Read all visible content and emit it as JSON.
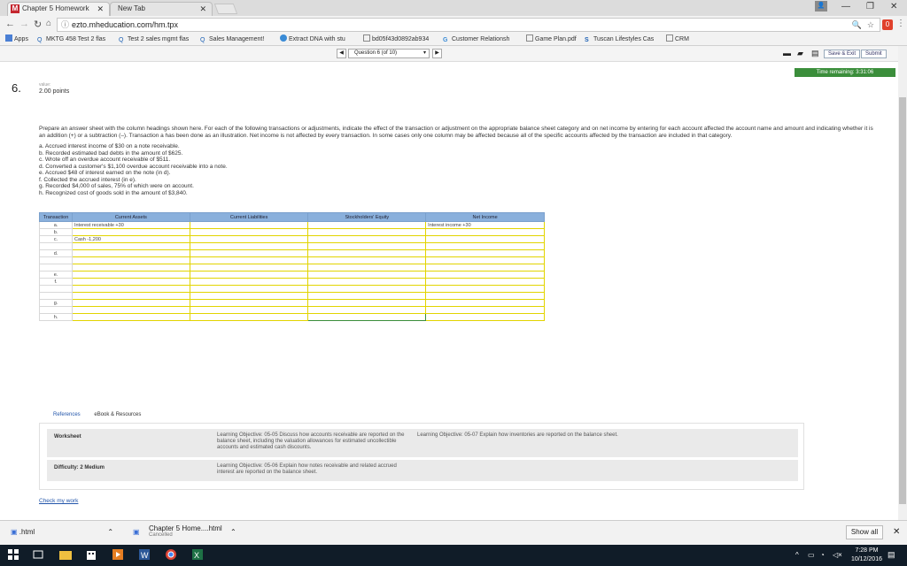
{
  "browser": {
    "tabs": [
      {
        "label": "Chapter 5 Homework",
        "active": true
      },
      {
        "label": "New Tab",
        "active": false
      }
    ],
    "url": "ezto.mheducation.com/hm.tpx",
    "bookmarks": [
      {
        "label": "Apps"
      },
      {
        "label": "MKTG 458 Test 2 flas"
      },
      {
        "label": "Test 2 sales mgmt flas"
      },
      {
        "label": "Sales Management!"
      },
      {
        "label": "Extract DNA with stu"
      },
      {
        "label": "bd05f43d0892ab934"
      },
      {
        "label": "Customer Relationsh"
      },
      {
        "label": "Game Plan.pdf"
      },
      {
        "label": "Tuscan Lifestyles Cas"
      },
      {
        "label": "CRM"
      }
    ]
  },
  "app": {
    "question_nav": "Question 6 (of 10)",
    "save_exit": "Save & Exit",
    "submit": "Submit",
    "timer": "Time remaining: 3:31:06",
    "question_number": "6.",
    "points_header": "value:",
    "points": "2.00 points",
    "instructions": "Prepare an answer sheet with the column headings shown here. For each of the following transactions or adjustments, indicate the effect of the transaction or adjustment on the appropriate balance sheet category and on net income by entering for each account affected the account name and amount and indicating whether it is an addition (+) or a subtraction (–). Transaction a has been done as an illustration. Net income is not affected by every transaction. In some cases only one column may be affected because all of the specific accounts affected by the transaction are included in that category.",
    "items": [
      "a. Accrued interest income of $30 on a note receivable.",
      "b. Recorded estimated bad debts in the amount of $625.",
      "c. Wrote off an overdue account receivable of $511.",
      "d. Converted a customer's $1,100 overdue account receivable into a note.",
      "e. Accrued $48 of interest earned on the note (in d).",
      "f. Collected the accrued interest (in e).",
      "g. Recorded $4,000 of sales, 75% of which were on account.",
      "h. Recognized cost of goods sold in the amount of $3,840."
    ],
    "table": {
      "headers": [
        "Transaction",
        "Current Assets",
        "Current Liabilities",
        "Stockholders' Equity",
        "Net Income"
      ],
      "rows": [
        {
          "tx": "a.",
          "ca": "Interest receivable +30",
          "cl": "",
          "se": "",
          "ni": "Interest income +30"
        },
        {
          "tx": "b.",
          "ca": "",
          "cl": "",
          "se": "",
          "ni": ""
        },
        {
          "tx": "c.",
          "ca": "Cash -1,200",
          "cl": "",
          "se": "",
          "ni": ""
        },
        {
          "tx": "",
          "ca": "",
          "cl": "",
          "se": "",
          "ni": ""
        },
        {
          "tx": "d.",
          "ca": "",
          "cl": "",
          "se": "",
          "ni": ""
        },
        {
          "tx": "",
          "ca": "",
          "cl": "",
          "se": "",
          "ni": ""
        },
        {
          "tx": "",
          "ca": "",
          "cl": "",
          "se": "",
          "ni": ""
        },
        {
          "tx": "e.",
          "ca": "",
          "cl": "",
          "se": "",
          "ni": ""
        },
        {
          "tx": "f.",
          "ca": "",
          "cl": "",
          "se": "",
          "ni": ""
        },
        {
          "tx": "",
          "ca": "",
          "cl": "",
          "se": "",
          "ni": ""
        },
        {
          "tx": "",
          "ca": "",
          "cl": "",
          "se": "",
          "ni": ""
        },
        {
          "tx": "g.",
          "ca": "",
          "cl": "",
          "se": "",
          "ni": ""
        },
        {
          "tx": "",
          "ca": "",
          "cl": "",
          "se": "",
          "ni": ""
        },
        {
          "tx": "h.",
          "ca": "",
          "cl": "",
          "se": "",
          "ni": ""
        }
      ]
    },
    "references_tab": "References",
    "ebook_tab": "eBook & Resources",
    "worksheet_label": "Worksheet",
    "lo1": "Learning Objective: 05-05 Discuss how accounts receivable are reported on the balance sheet, including the valuation allowances for estimated uncollectible accounts and estimated cash discounts.",
    "lo2": "Learning Objective: 05-07 Explain how inventories are reported on the balance sheet.",
    "difficulty_label": "Difficulty: 2 Medium",
    "lo3": "Learning Objective: 05-06 Explain how notes receivable and related accrued interest are reported on the balance sheet.",
    "check_work": "Check my work"
  },
  "downloads": {
    "item1": ".html",
    "item2_name": "Chapter 5 Home....html",
    "item2_status": "Cancelled",
    "show_all": "Show all"
  },
  "taskbar": {
    "time": "7:28 PM",
    "date": "10/12/2016"
  }
}
